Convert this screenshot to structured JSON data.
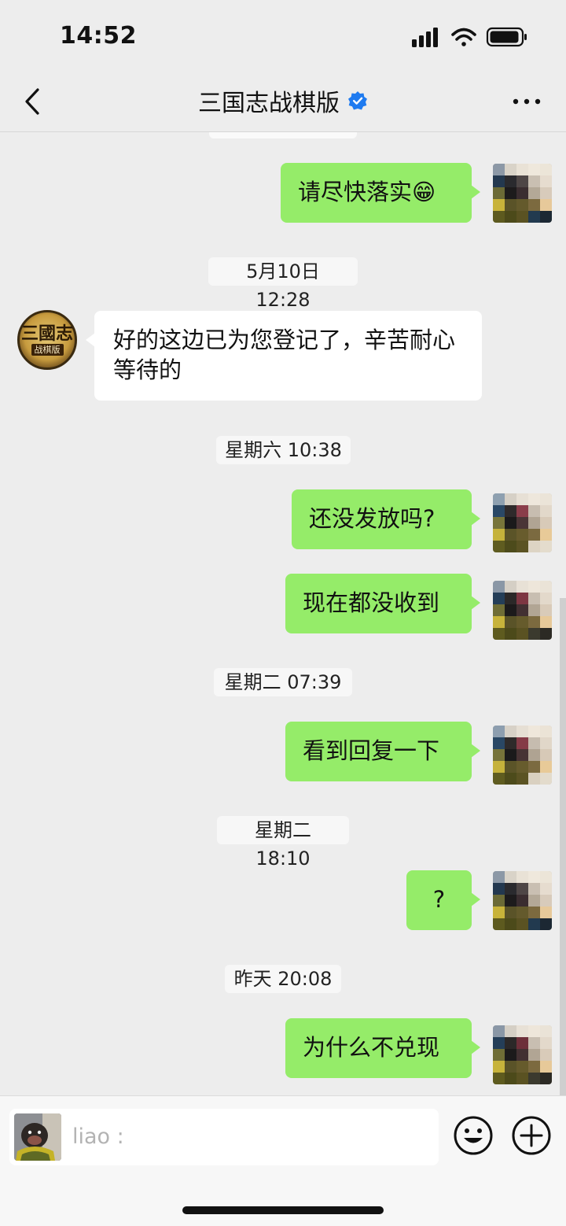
{
  "status_bar": {
    "time": "14:52",
    "icons": [
      "signal-icon",
      "wifi-icon",
      "battery-icon"
    ]
  },
  "nav": {
    "title": "三国志战棋版",
    "verified": true,
    "icons": [
      "back-icon",
      "verified-icon",
      "more-icon"
    ]
  },
  "messages": [
    {
      "type": "out",
      "text": "请尽快落实😁"
    },
    {
      "type": "time",
      "text": "5月10日 12:28"
    },
    {
      "type": "in",
      "text": "好的这边已为您登记了，辛苦耐心等待的"
    },
    {
      "type": "time",
      "text": "星期六 10:38"
    },
    {
      "type": "out",
      "text": "还没发放吗?"
    },
    {
      "type": "out",
      "text": "现在都没收到"
    },
    {
      "type": "time",
      "text": "星期二 07:39"
    },
    {
      "type": "out",
      "text": "看到回复一下"
    },
    {
      "type": "time",
      "text": "星期二 18:10"
    },
    {
      "type": "out",
      "text": "?"
    },
    {
      "type": "time",
      "text": "昨天 20:08"
    },
    {
      "type": "out",
      "text": "为什么不兑现"
    }
  ],
  "game_avatar": {
    "logo_text": "三國志",
    "logo_subtext": "战棋版"
  },
  "input_bar": {
    "placeholder": "liao :",
    "icons": [
      "emoji-icon",
      "plus-icon"
    ]
  },
  "colors": {
    "background": "#ededed",
    "outgoing_bubble": "#95ec69",
    "incoming_bubble": "#ffffff",
    "verified_badge": "#1f7bf0"
  }
}
